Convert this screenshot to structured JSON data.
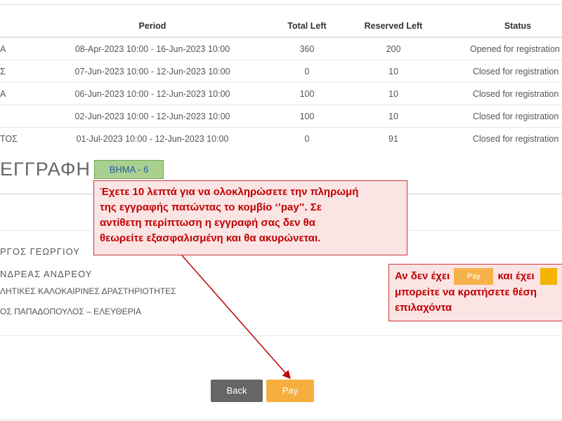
{
  "table": {
    "headers": {
      "period": "Period",
      "total_left": "Total Left",
      "reserved_left": "Reserved Left",
      "status": "Status"
    },
    "rows": [
      {
        "name": "Α",
        "period": "08-Apr-2023 10:00 - 16-Jun-2023 10:00",
        "total_left": "360",
        "reserved_left": "200",
        "status": "Opened for registration"
      },
      {
        "name": "Σ",
        "period": "07-Jun-2023 10:00 - 12-Jun-2023 10:00",
        "total_left": "0",
        "reserved_left": "10",
        "status": "Closed for registration"
      },
      {
        "name": "Α",
        "period": "06-Jun-2023 10:00 - 12-Jun-2023 10:00",
        "total_left": "100",
        "reserved_left": "10",
        "status": "Closed for registration"
      },
      {
        "name": "",
        "period": "02-Jun-2023 10:00 - 12-Jun-2023 10:00",
        "total_left": "100",
        "reserved_left": "10",
        "status": "Closed for registration"
      },
      {
        "name": "ΤΟΣ",
        "period": "01-Jul-2023 10:00 - 12-Jun-2023 10:00",
        "total_left": "0",
        "reserved_left": "91",
        "status": "Closed for registration"
      }
    ]
  },
  "section": {
    "title": "ΕΓΓΡΑΦΗ",
    "step_badge": "ΒΗΜΑ - 6"
  },
  "participants": {
    "p1_name": "ΡΓΟΣ ΓΕΩΡΓΙΟΥ",
    "p2_name": "ΝΔΡΕΑΣ ΑΝΔΡΕΟΥ",
    "p2_activity_1": "ΛΗΤΙΚΕΣ ΚΑΛΟΚΑΙΡΙΝΕΣ ΔΡΑΣΤΗΡΙΟΤΗΤΕΣ",
    "p2_activity_2": "ΟΣ ΠΑΠΑΔΟΠΟΥΛΟΣ – ΕΛΕΥΘΕΡΙΑ"
  },
  "callout_main": {
    "line1": "Έχετε 10 λεπτά για να ολοκληρώσετε την πληρωμή",
    "line2": "της εγγραφής πατώντας το κομβίο ‘’pay’’.  Σε",
    "line3": "αντίθετη περίπτωση η εγγραφή σας δεν θα",
    "line4": "θεωρείτε εξασφαλισμένη και θα ακυρώνεται."
  },
  "callout_side": {
    "text_a": "Αν δεν έχει",
    "pay_label": "Pay",
    "text_b": "και έχει",
    "line2": "μπορείτε να κρατήσετε θέση",
    "line3": "επιλαχόντα"
  },
  "buttons": {
    "back": "Back",
    "pay": "Pay"
  },
  "colors": {
    "pay_button": "#f6ae3e",
    "back_button": "#666666",
    "callout_text": "#c00000",
    "callout_bg": "#fbe4e4",
    "step_badge_bg": "#a9d08e"
  }
}
